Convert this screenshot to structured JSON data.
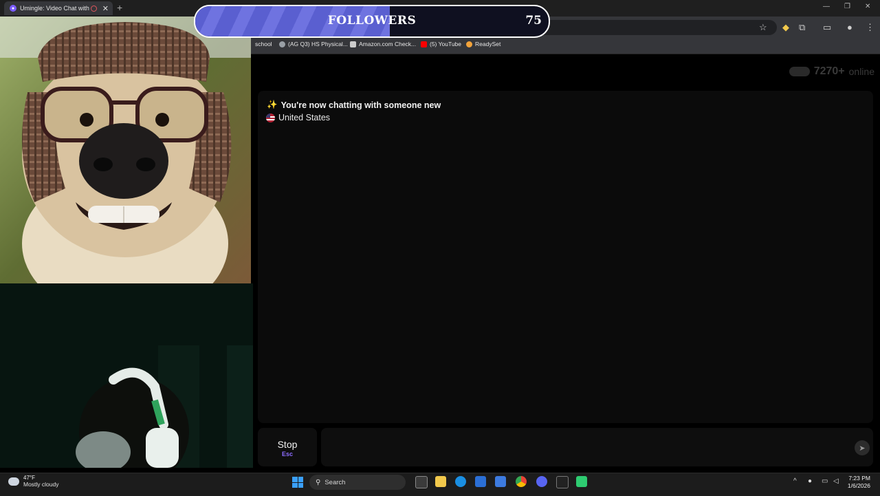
{
  "browser": {
    "tab_title": "Umingle: Video Chat with S",
    "bookmarks": [
      {
        "label": "school",
        "color": "#8a8a8a"
      },
      {
        "label": "(AG Q3) HS Physical...",
        "color": "#9aa0a6"
      },
      {
        "label": "Amazon.com Check...",
        "color": "#cccccc"
      },
      {
        "label": "(5) YouTube",
        "color": "#ff0000"
      },
      {
        "label": "ReadySet",
        "color": "#f2a33a"
      }
    ]
  },
  "overlay": {
    "followers_label": "FOLLOWERS",
    "followers_count": "75",
    "progress_fraction": 0.55
  },
  "page": {
    "online_count": "7270+",
    "online_label": "online"
  },
  "chat": {
    "status_message": "You're now chatting with someone new",
    "status_emoji": "✨",
    "country": "United States"
  },
  "controls": {
    "stop_label": "Stop",
    "stop_shortcut": "Esc",
    "send_icon": "send-icon"
  },
  "taskbar": {
    "temperature": "47°F",
    "weather": "Mostly cloudy",
    "search_label": "Search",
    "time": "7:23 PM",
    "date": "1/6/2026"
  },
  "colors": {
    "accent": "#8c6cff",
    "followers_fill": "#5a5fd0"
  }
}
